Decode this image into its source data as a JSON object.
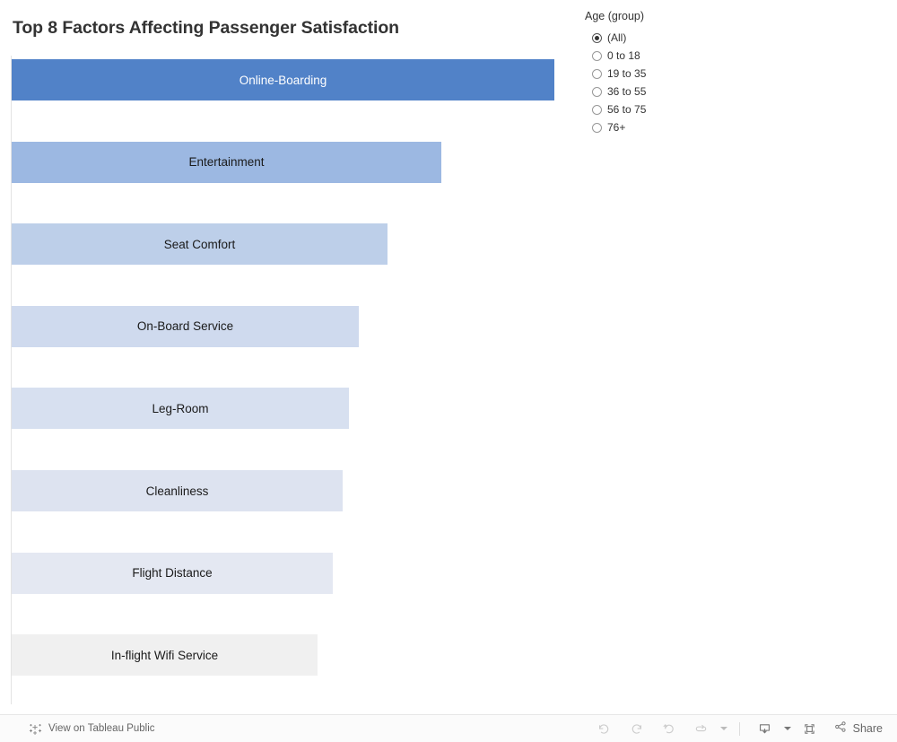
{
  "chart": {
    "title": "Top 8 Factors Affecting Passenger Satisfaction"
  },
  "chart_data": {
    "type": "bar",
    "orientation": "horizontal",
    "title": "Top 8 Factors Affecting Passenger Satisfaction",
    "xlabel": "",
    "ylabel": "",
    "grid": false,
    "axis_labels_visible": false,
    "value_labels_visible": false,
    "legend": "none",
    "categories": [
      "Online-Boarding",
      "Entertainment",
      "Seat Comfort",
      "On-Board Service",
      "Leg-Room",
      "Cleanliness",
      "Flight Distance",
      "In-flight Wifi Service"
    ],
    "bar_pixel_widths": [
      605,
      479,
      419,
      387,
      376,
      369,
      358,
      341
    ],
    "values": [
      100,
      79.2,
      69.3,
      64.0,
      62.1,
      61.0,
      59.2,
      56.4
    ],
    "xlim": [
      0,
      100
    ],
    "colors": [
      "#5182c8",
      "#9cb8e2",
      "#bdcfe9",
      "#cfdaee",
      "#d7e0f0",
      "#dde3f0",
      "#e4e8f2",
      "#f0f0f0"
    ],
    "label_text_colors": [
      "#ffffff",
      "#1a1a1a",
      "#1a1a1a",
      "#1a1a1a",
      "#1a1a1a",
      "#1a1a1a",
      "#1a1a1a",
      "#1a1a1a"
    ]
  },
  "filter": {
    "title": "Age (group)",
    "selected": "(All)",
    "options": [
      "(All)",
      "0 to 18",
      "19 to 35",
      "36 to 55",
      "56 to 75",
      "76+"
    ]
  },
  "toolbar": {
    "view_on_tableau_public": "View on Tableau Public",
    "logo_icon": "tableau-logo-icon",
    "buttons": [
      {
        "name": "undo-button",
        "icon": "undo-icon",
        "enabled": false
      },
      {
        "name": "redo-button",
        "icon": "redo-icon",
        "enabled": false
      },
      {
        "name": "revert-button",
        "icon": "revert-icon",
        "enabled": false
      },
      {
        "name": "refresh-button",
        "icon": "refresh-icon",
        "enabled": false
      }
    ],
    "download_icon": "download-icon",
    "fullscreen_icon": "fullscreen-icon",
    "share_icon": "share-icon",
    "share_label": "Share"
  }
}
